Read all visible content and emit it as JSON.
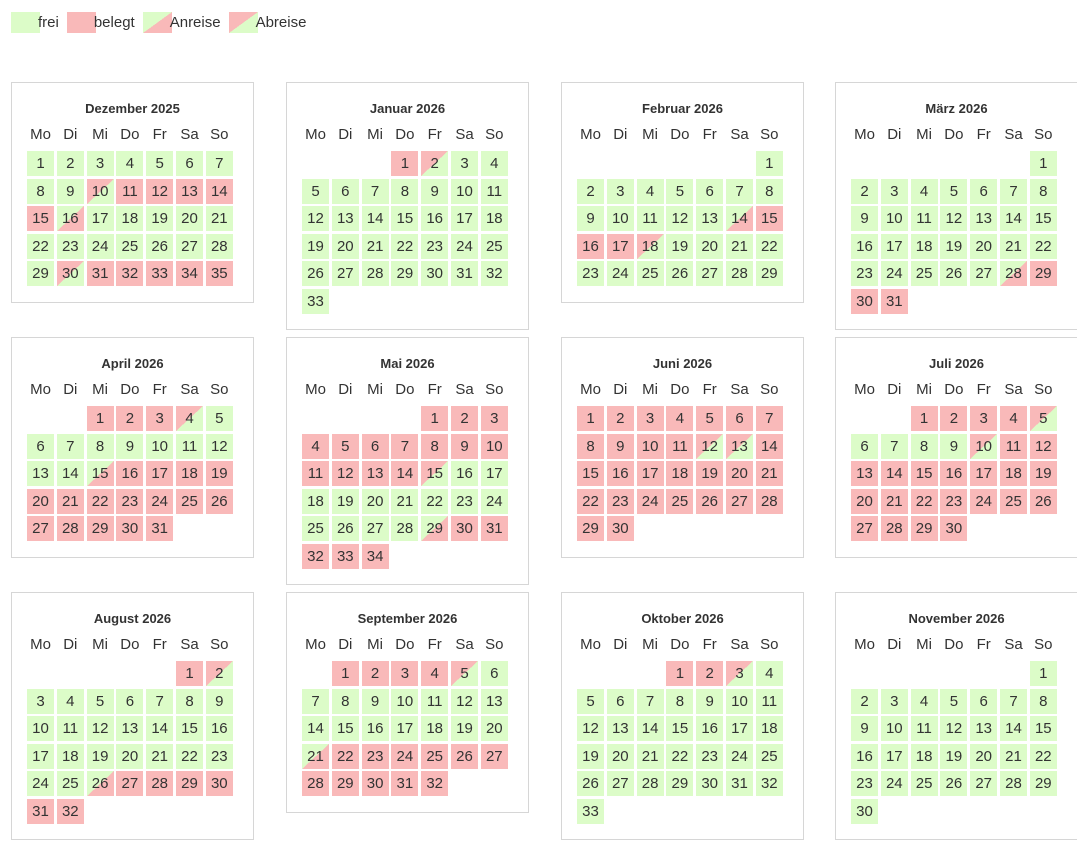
{
  "legend": [
    {
      "label": "frei",
      "status": "f"
    },
    {
      "label": "belegt",
      "status": "b"
    },
    {
      "label": "Anreise",
      "status": "a"
    },
    {
      "label": "Abreise",
      "status": "r"
    }
  ],
  "colors": {
    "frei": "#dcfcc8",
    "belegt": "#f9b9b9"
  },
  "weekdays": [
    "Mo",
    "Di",
    "Mi",
    "Do",
    "Fr",
    "Sa",
    "So"
  ],
  "months": [
    {
      "title": "Dezember 2025",
      "offset": 0,
      "status": "fffffffffrbbbbbafffffffffffffrbbbbb"
    },
    {
      "title": "Januar 2026",
      "offset": 3,
      "status": "brfffffffffffffffffffffffffffffff"
    },
    {
      "title": "Februar 2026",
      "offset": 6,
      "status": "fffffffffffffabbbrfffffffffff"
    },
    {
      "title": "März 2026",
      "offset": 6,
      "status": "fffffffffffffffffffffffffffabbb"
    },
    {
      "title": "April 2026",
      "offset": 2,
      "status": "bbbrffffffffffabbbbbbbbbbbbbbbb"
    },
    {
      "title": "Mai 2026",
      "offset": 4,
      "status": "bbbbbbbbbbbbbbrfffffffffffffabbbbb"
    },
    {
      "title": "Juni 2026",
      "offset": 0,
      "status": "bbbbbbbbbbbrrbbbbbbbbbbbbbbbbb"
    },
    {
      "title": "Juli 2026",
      "offset": 2,
      "status": "bbbbrffffrbbbbbbbbbbbbbbbbbbbb"
    },
    {
      "title": "August 2026",
      "offset": 5,
      "status": "brfffffffffffffffffffffffabbbbbb"
    },
    {
      "title": "September 2026",
      "offset": 1,
      "status": "bbbbrfffffffffffffffabbbbbbbbbbb"
    },
    {
      "title": "Oktober 2026",
      "offset": 3,
      "status": "bbrffffffffffffffffffffffffffffff"
    },
    {
      "title": "November 2026",
      "offset": 6,
      "status": "ffffffffffffffffffffffffffffff"
    }
  ]
}
